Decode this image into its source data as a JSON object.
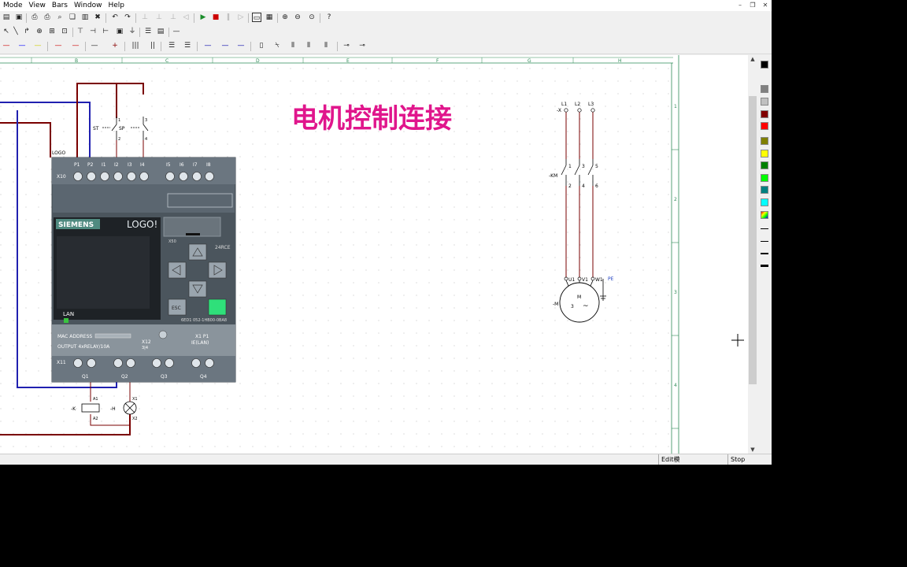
{
  "menu": [
    "Mode",
    "View",
    "Bars",
    "Window",
    "Help"
  ],
  "window_controls": {
    "minimize": "–",
    "restore": "❐",
    "close": "✕"
  },
  "ruler_labels": [
    "B",
    "C",
    "D",
    "E",
    "F",
    "G",
    "H"
  ],
  "ruler_right_labels": [
    "1",
    "2",
    "3",
    "4"
  ],
  "canvas": {
    "title": "电机控制连接",
    "title_color": "#e0168c",
    "logo_label": "LOGO",
    "switch_st": "ST",
    "switch_sp": "SP",
    "sw_terms": [
      "1",
      "2",
      "3",
      "4"
    ],
    "device": {
      "top_label": "X10",
      "inputs": [
        "P1",
        "P2",
        "I1",
        "I2",
        "I3",
        "I4",
        "I5",
        "I6",
        "I7",
        "I8"
      ],
      "brand": "SIEMENS",
      "product": "LOGO!",
      "x50": "X50",
      "model_code": "24RCE",
      "lan": "LAN",
      "esc": "ESC",
      "part_number": "6ED1 052-1HB00-0BA8",
      "mac": "MAC ADDRESS",
      "output_desc": "OUTPUT 4xRELAY/10A",
      "x12": "X12",
      "x12_pins": "3|4",
      "x1p1": "X1 P1",
      "ie_lan": "IE(LAN)",
      "bottom_label": "X11",
      "outputs": [
        "Q1",
        "Q2",
        "Q3",
        "Q4"
      ]
    },
    "coil": {
      "name": "-K",
      "t1": "A1",
      "t2": "A2"
    },
    "lamp": {
      "name": "-H",
      "t1": "X1",
      "t2": "X2"
    },
    "motor_circuit": {
      "supply": [
        "L1",
        "L2",
        "L3"
      ],
      "fuse_tag": "-X",
      "contactor_tag": "-KM",
      "contact_top": [
        "1",
        "3",
        "5"
      ],
      "contact_bottom": [
        "2",
        "4",
        "6"
      ],
      "motor_terms": [
        "U1",
        "V1",
        "W1"
      ],
      "pe": "PE",
      "motor_tag": "-M",
      "motor_letter": "M",
      "motor_phase": "3",
      "motor_symbol": "~"
    }
  },
  "palette_colors": [
    "#000000",
    "#808080",
    "#c0c0c0",
    "#ffffff",
    "#800000",
    "#ff0000",
    "#808000",
    "#ffff00",
    "#008000",
    "#00ff00",
    "#008080",
    "#00ffff"
  ],
  "status": {
    "edit": "Edit模",
    "mode": "Stop"
  }
}
